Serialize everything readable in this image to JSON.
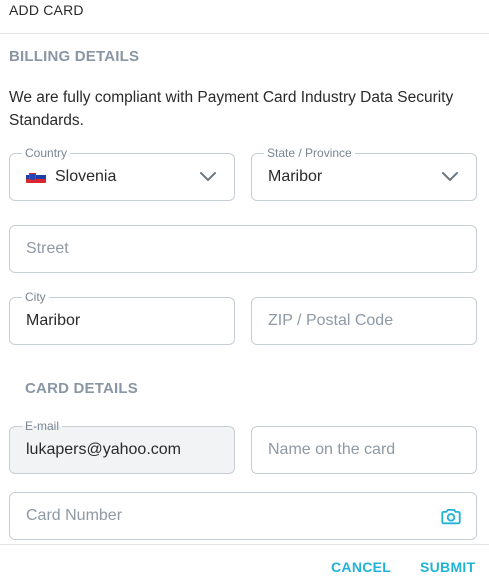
{
  "header": {
    "title": "ADD CARD"
  },
  "billing": {
    "section_title": "BILLING DETAILS",
    "description": "We are fully compliant with Payment Card Industry Data Security Standards.",
    "country": {
      "label": "Country",
      "value": "Slovenia",
      "flag": "slovenia-flag"
    },
    "state": {
      "label": "State / Province",
      "value": "Maribor"
    },
    "street": {
      "placeholder": "Street"
    },
    "city": {
      "label": "City",
      "value": "Maribor"
    },
    "zip": {
      "placeholder": "ZIP / Postal Code"
    }
  },
  "card": {
    "section_title": "CARD DETAILS",
    "email": {
      "label": "E-mail",
      "value": "lukapers@yahoo.com"
    },
    "name": {
      "placeholder": "Name on the card"
    },
    "number": {
      "placeholder": "Card Number",
      "icon": "camera-icon"
    }
  },
  "footer": {
    "cancel_label": "CANCEL",
    "submit_label": "SUBMIT"
  },
  "colors": {
    "accent": "#21b3d6",
    "section": "#8a96a3",
    "border": "#c8ced5"
  }
}
